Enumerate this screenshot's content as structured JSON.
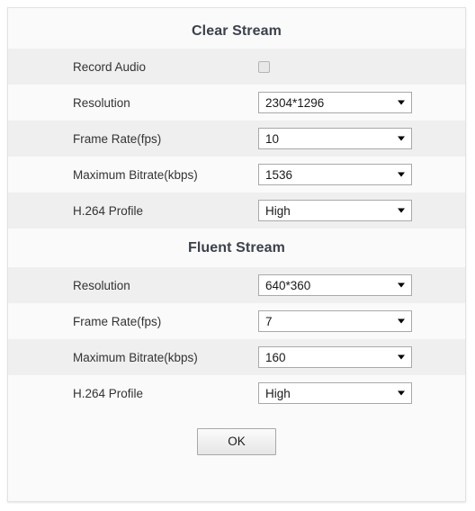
{
  "dialog": {
    "background_color": "#fafafa",
    "border_color": "#e2e2e2",
    "stripe_gray": "#efefef",
    "stripe_white": "#fafafa",
    "header_color": "#3c414c"
  },
  "sections": [
    {
      "title": "Clear Stream",
      "rows": [
        {
          "label": "Record Audio",
          "control": "checkbox",
          "checked": false,
          "icon": "checkbox-unchecked-icon"
        },
        {
          "label": "Resolution",
          "control": "select",
          "value": "2304*1296",
          "icon": "chevron-down-icon"
        },
        {
          "label": "Frame Rate(fps)",
          "control": "select",
          "value": "10",
          "icon": "chevron-down-icon"
        },
        {
          "label": "Maximum Bitrate(kbps)",
          "control": "select",
          "value": "1536",
          "icon": "chevron-down-icon"
        },
        {
          "label": "H.264 Profile",
          "control": "select",
          "value": "High",
          "icon": "chevron-down-icon"
        }
      ]
    },
    {
      "title": "Fluent Stream",
      "rows": [
        {
          "label": "Resolution",
          "control": "select",
          "value": "640*360",
          "icon": "chevron-down-icon"
        },
        {
          "label": "Frame Rate(fps)",
          "control": "select",
          "value": "7",
          "icon": "chevron-down-icon"
        },
        {
          "label": "Maximum Bitrate(kbps)",
          "control": "select",
          "value": "160",
          "icon": "chevron-down-icon"
        },
        {
          "label": "H.264 Profile",
          "control": "select",
          "value": "High",
          "icon": "chevron-down-icon"
        }
      ]
    }
  ],
  "footer": {
    "ok_label": "OK"
  }
}
